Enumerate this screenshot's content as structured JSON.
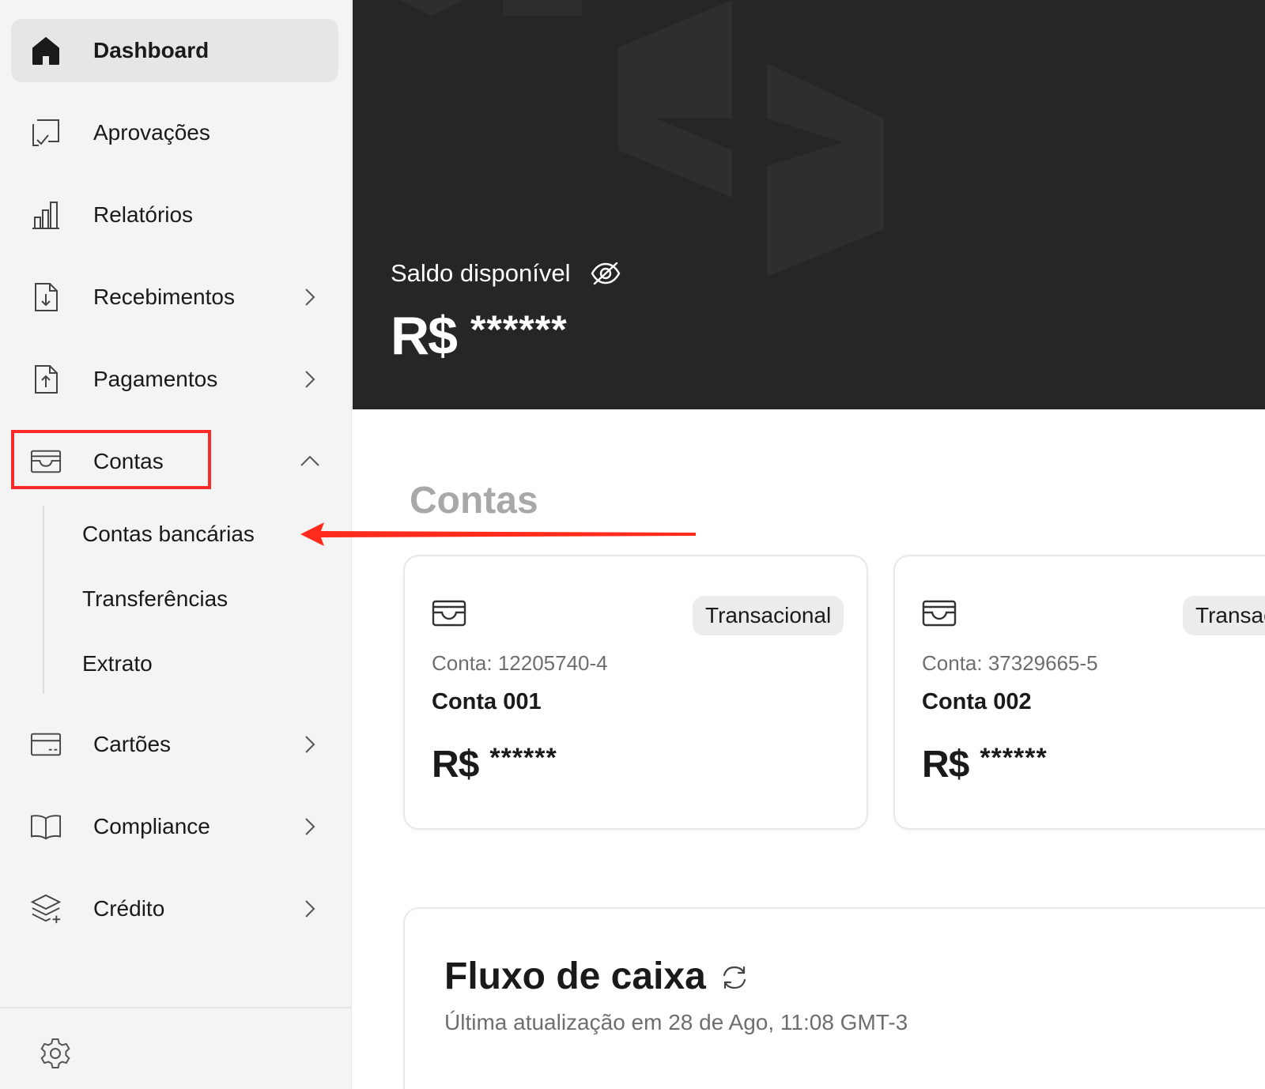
{
  "sidebar": {
    "items": [
      {
        "label": "Dashboard",
        "icon": "home-icon"
      },
      {
        "label": "Aprovações",
        "icon": "approval-icon"
      },
      {
        "label": "Relatórios",
        "icon": "bar-chart-icon"
      },
      {
        "label": "Recebimentos",
        "icon": "file-download-icon"
      },
      {
        "label": "Pagamentos",
        "icon": "file-upload-icon"
      },
      {
        "label": "Contas",
        "icon": "wallet-icon"
      },
      {
        "label": "Cartões",
        "icon": "credit-card-icon"
      },
      {
        "label": "Compliance",
        "icon": "book-icon"
      },
      {
        "label": "Crédito",
        "icon": "layers-plus-icon"
      }
    ],
    "submenu": [
      "Contas bancárias",
      "Transferências",
      "Extrato"
    ],
    "settings_icon": "gear-icon"
  },
  "hero": {
    "balance_label": "Saldo disponível",
    "currency": "R$",
    "masked_value": "******"
  },
  "accounts": {
    "title": "Contas",
    "cards": [
      {
        "badge": "Transacional",
        "number": "Conta: 12205740-4",
        "name": "Conta 001",
        "currency": "R$",
        "masked": "******"
      },
      {
        "badge": "Transacional",
        "number": "Conta: 37329665-5",
        "name": "Conta 002",
        "currency": "R$",
        "masked": "******"
      }
    ]
  },
  "cashflow": {
    "title": "Fluxo de caixa",
    "updated": "Última atualização em 28 de Ago, 11:08 GMT-3"
  },
  "colors": {
    "hero_bg": "#262626",
    "sidebar_bg": "#f4f4f4",
    "highlight": "#ff2b2b"
  }
}
